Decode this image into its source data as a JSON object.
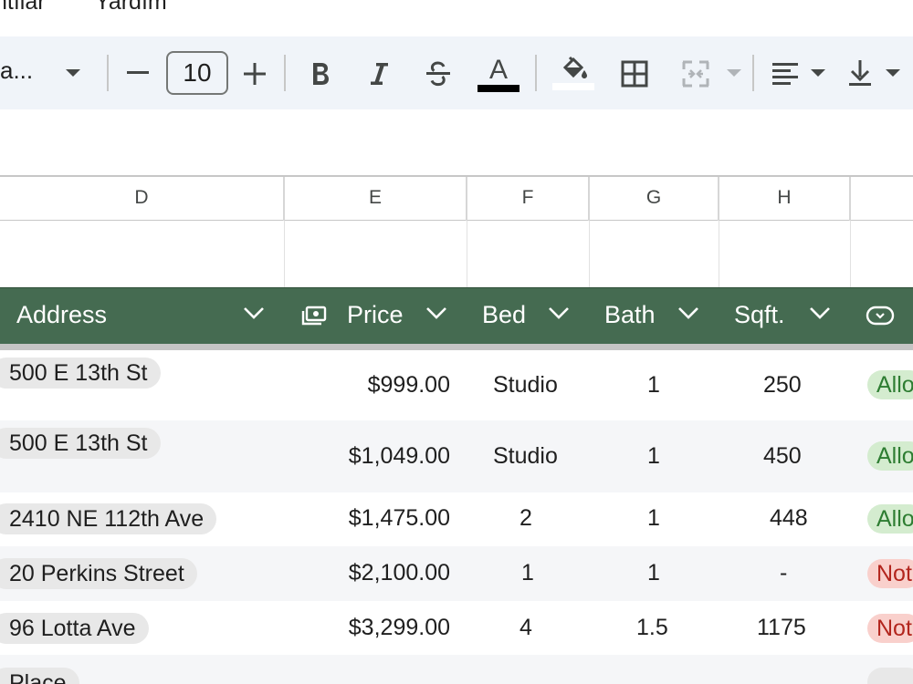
{
  "menu": {
    "items": [
      "ntılar",
      "Yardım"
    ]
  },
  "toolbar": {
    "font_name": "a...",
    "font_size": "10",
    "text_color_letter": "A"
  },
  "grid": {
    "columns": [
      "D",
      "E",
      "F",
      "G",
      "H"
    ]
  },
  "table": {
    "headers": [
      "Address",
      "Price",
      "Bed",
      "Bath",
      "Sqft."
    ],
    "rows": [
      {
        "address": "500 E 13th St",
        "price": "$999.00",
        "bed": "Studio",
        "bath": "1",
        "sqft": "250",
        "status": "Allo"
      },
      {
        "address": "500 E 13th St",
        "price": "$1,049.00",
        "bed": "Studio",
        "bath": "1",
        "sqft": "450",
        "status": "Allo"
      },
      {
        "address": "2410 NE 112th Ave",
        "price": "$1,475.00",
        "bed": "2",
        "bath": "1",
        "sqft": "448",
        "status": "Allo"
      },
      {
        "address": "20 Perkins Street",
        "price": "$2,100.00",
        "bed": "1",
        "bath": "1",
        "sqft": "-",
        "status": "Not"
      },
      {
        "address": "96 Lotta Ave",
        "price": "$3,299.00",
        "bed": "4",
        "bath": "1.5",
        "sqft": "1175",
        "status": "Not"
      },
      {
        "address": "Place"
      }
    ]
  },
  "colors": {
    "header_green": "#456b51",
    "status_ok": "#d4eccf",
    "status_no": "#f9d0cc"
  }
}
